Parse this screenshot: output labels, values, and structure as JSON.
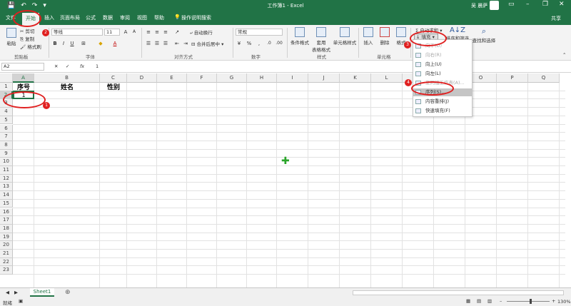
{
  "window": {
    "title": "工作簿1 - Excel",
    "user": "吴 晨萨",
    "share": "共享"
  },
  "tabs": [
    {
      "label": "文件"
    },
    {
      "label": "开始"
    },
    {
      "label": "插入"
    },
    {
      "label": "页面布局"
    },
    {
      "label": "公式"
    },
    {
      "label": "数据"
    },
    {
      "label": "审阅"
    },
    {
      "label": "视图"
    },
    {
      "label": "帮助"
    },
    {
      "label": "操作说明搜索"
    }
  ],
  "ribbon": {
    "clipboard": {
      "paste": "粘贴",
      "cut": "剪切",
      "copy": "复制",
      "format_painter": "格式刷",
      "label": "剪贴板"
    },
    "font": {
      "name": "等线",
      "size": "11",
      "label": "字体"
    },
    "alignment": {
      "wrap": "自动换行",
      "merge": "合并后居中",
      "label": "对齐方式"
    },
    "number": {
      "format": "常规",
      "label": "数字"
    },
    "styles": {
      "conditional": "条件格式",
      "table_line1": "套用",
      "table_line2": "表格格式",
      "cell_styles": "单元格样式",
      "label": "样式"
    },
    "cells": {
      "insert": "插入",
      "delete": "删除",
      "format": "格式",
      "label": "单元格"
    },
    "editing": {
      "autosum": "自动求和",
      "fill": "填充",
      "sort": "排序和筛选",
      "find": "查找和选择"
    }
  },
  "fill_menu": [
    {
      "label": "向下(D)",
      "disabled": true
    },
    {
      "label": "向右(R)",
      "disabled": true
    },
    {
      "label": "向上(U)",
      "disabled": false
    },
    {
      "label": "向左(L)",
      "disabled": false
    },
    {
      "label": "至同组工作表(A)...",
      "disabled": true
    },
    {
      "label": "序列(S)...",
      "disabled": false,
      "hover": true
    },
    {
      "label": "内容重排(J)",
      "disabled": false
    },
    {
      "label": "快速填充(F)",
      "disabled": false
    }
  ],
  "formula_bar": {
    "cell_ref": "A2",
    "fx": "fx",
    "value": "1"
  },
  "columns": [
    "A",
    "B",
    "C",
    "D",
    "E",
    "F",
    "G",
    "H",
    "I",
    "J",
    "K",
    "L",
    "M",
    "N",
    "O",
    "P",
    "Q"
  ],
  "rows": [
    "1",
    "2",
    "3",
    "4",
    "5",
    "6",
    "7",
    "8",
    "9",
    "10",
    "11",
    "12",
    "13",
    "14",
    "15",
    "16",
    "17",
    "18",
    "19",
    "20",
    "21",
    "22",
    "23"
  ],
  "cells": {
    "A1": "序号",
    "B1": "姓名",
    "C1": "性别",
    "A2": "1"
  },
  "sheets": [
    {
      "name": "Sheet1"
    }
  ],
  "status": {
    "ready": "就绪",
    "zoom": "130%"
  },
  "annotations": [
    "1",
    "2",
    "3",
    "4"
  ],
  "colors": {
    "excel_green": "#217346",
    "annotation_red": "#e02020"
  }
}
